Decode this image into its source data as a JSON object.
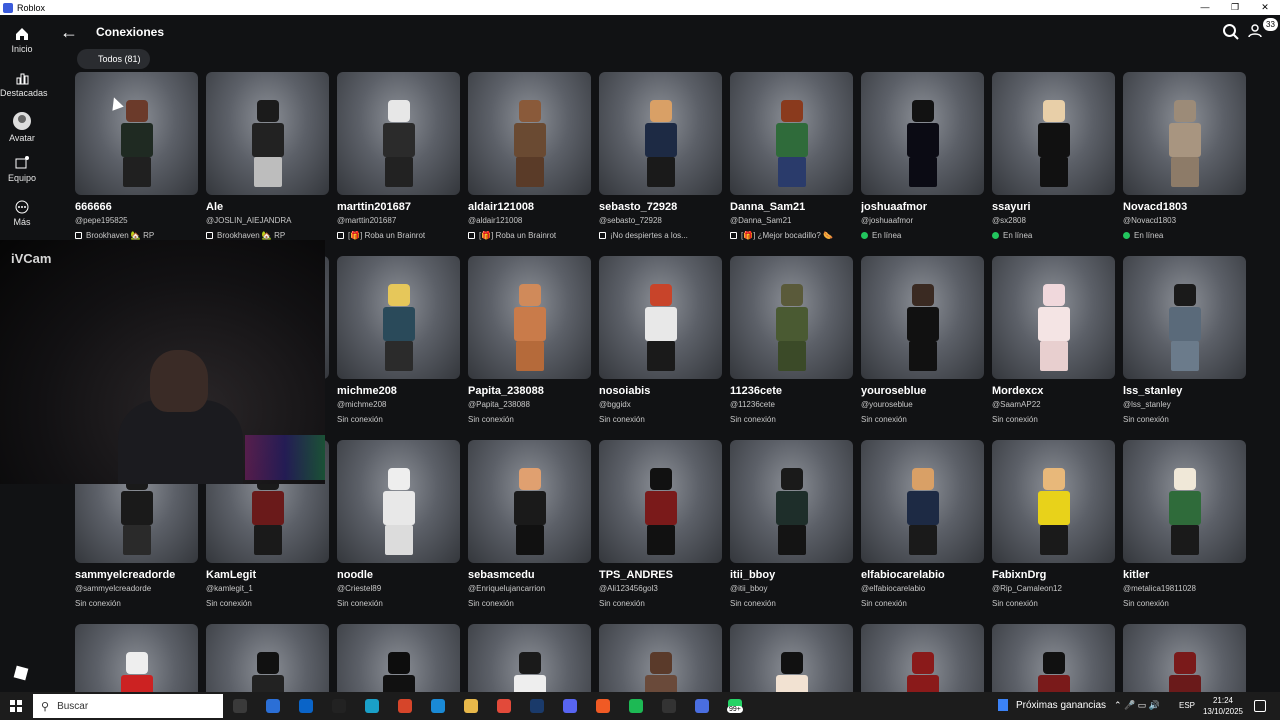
{
  "window": {
    "title": "Roblox",
    "controls": [
      "—",
      "❐",
      "✕"
    ]
  },
  "sidebar": {
    "items": [
      {
        "label": "Inicio",
        "icon": "home-icon"
      },
      {
        "label": "Destacadas",
        "icon": "chart-icon"
      },
      {
        "label": "Avatar",
        "icon": "avatar-icon"
      },
      {
        "label": "Equipo",
        "icon": "party-icon"
      },
      {
        "label": "Más",
        "icon": "more-icon"
      }
    ]
  },
  "header": {
    "title": "Conexiones",
    "notification_count": "33"
  },
  "filter": {
    "label": "Todos (81)"
  },
  "webcam": {
    "label": "iVCam"
  },
  "colors": {
    "online": "#22c55e",
    "card_bg": "#5c6068",
    "app_bg": "#111214"
  },
  "connections": [
    {
      "name": "666666",
      "handle": "@pepe195825",
      "status": "Brookhaven 🏡 RP",
      "status_type": "game",
      "head": "#6b3a2a",
      "body": "#1f2a22",
      "legs": "#202020"
    },
    {
      "name": "Ale",
      "handle": "@JOSLIN_AIEJANDRA",
      "status": "Brookhaven 🏡 RP",
      "status_type": "game",
      "head": "#1b1b1b",
      "body": "#222",
      "legs": "#bdbdbd"
    },
    {
      "name": "marttin201687",
      "handle": "@marttin201687",
      "status": "[🎁] Roba un Brainrot",
      "status_type": "game",
      "head": "#e7e7e7",
      "body": "#2b2b2b",
      "legs": "#222"
    },
    {
      "name": "aldair121008",
      "handle": "@aldair121008",
      "status": "[🎁] Roba un Brainrot",
      "status_type": "game",
      "head": "#8a5a3a",
      "body": "#6a4a32",
      "legs": "#5a3b28"
    },
    {
      "name": "sebasto_72928",
      "handle": "@sebasto_72928",
      "status": "¡No despiertes a los...",
      "status_type": "game",
      "head": "#d9a066",
      "body": "#1d2a44",
      "legs": "#1a1a1a"
    },
    {
      "name": "Danna_Sam21",
      "handle": "@Danna_Sam21",
      "status": "[🎁] ¿Mejor bocadillo? 🌭",
      "status_type": "game",
      "head": "#8a3a1d",
      "body": "#2f6b3a",
      "legs": "#2a3b6b"
    },
    {
      "name": "joshuaafmor",
      "handle": "@joshuaafmor",
      "status": "En línea",
      "status_type": "online",
      "head": "#121212",
      "body": "#0b0b14",
      "legs": "#0b0b14"
    },
    {
      "name": "ssayuri",
      "handle": "@sx2808",
      "status": "En línea",
      "status_type": "online",
      "head": "#e8cfa8",
      "body": "#111",
      "legs": "#111"
    },
    {
      "name": "Novacd1803",
      "handle": "@Novacd1803",
      "status": "En línea",
      "status_type": "online",
      "head": "#9c8b78",
      "body": "#a89580",
      "legs": "#8d7b68"
    },
    {
      "name": "",
      "handle": "",
      "status": "",
      "status_type": "hidden",
      "head": "#555",
      "body": "#444",
      "legs": "#333"
    },
    {
      "name": "",
      "handle": "",
      "status": "",
      "status_type": "hidden",
      "head": "#555",
      "body": "#444",
      "legs": "#333"
    },
    {
      "name": "michme208",
      "handle": "@michme208",
      "status": "Sin conexión",
      "status_type": "offline",
      "head": "#e6c75a",
      "body": "#2a4a5a",
      "legs": "#2b2b2b"
    },
    {
      "name": "Papita_238088",
      "handle": "@Papita_238088",
      "status": "Sin conexión",
      "status_type": "offline",
      "head": "#d08a5a",
      "body": "#c97b4a",
      "legs": "#b56a3a"
    },
    {
      "name": "nosoiabis",
      "handle": "@bggidx",
      "status": "Sin conexión",
      "status_type": "offline",
      "head": "#c8442a",
      "body": "#e8e8e8",
      "legs": "#1a1a1a"
    },
    {
      "name": "11236cete",
      "handle": "@11236cete",
      "status": "Sin conexión",
      "status_type": "offline",
      "head": "#5a5a3a",
      "body": "#4a5a32",
      "legs": "#3b4a28"
    },
    {
      "name": "youroseblue",
      "handle": "@youroseblue",
      "status": "Sin conexión",
      "status_type": "offline",
      "head": "#3a2a22",
      "body": "#111",
      "legs": "#111"
    },
    {
      "name": "Mordexcx",
      "handle": "@SaamAP22",
      "status": "Sin conexión",
      "status_type": "offline",
      "head": "#f0d8dc",
      "body": "#f4e4e4",
      "legs": "#e8cfcf"
    },
    {
      "name": "lss_stanley",
      "handle": "@lss_stanley",
      "status": "Sin conexión",
      "status_type": "offline",
      "head": "#1a1a1a",
      "body": "#5a6a7a",
      "legs": "#6b7b8b"
    },
    {
      "name": "sammyelcreadorde",
      "handle": "@sammyelcreadorde",
      "status": "Sin conexión",
      "status_type": "offline",
      "head": "#1a1a1a",
      "body": "#1a1a1a",
      "legs": "#2a2a2a"
    },
    {
      "name": "KamLegit",
      "handle": "@kamlegit_1",
      "status": "Sin conexión",
      "status_type": "offline",
      "head": "#1a1a1a",
      "body": "#6a1a1a",
      "legs": "#1a1a1a"
    },
    {
      "name": "noodle",
      "handle": "@Criestel89",
      "status": "Sin conexión",
      "status_type": "offline",
      "head": "#eeeeee",
      "body": "#e8e8e8",
      "legs": "#dcdcdc"
    },
    {
      "name": "sebasmcedu",
      "handle": "@Enriquelujancarrion",
      "status": "Sin conexión",
      "status_type": "offline",
      "head": "#e0a070",
      "body": "#1a1a1a",
      "legs": "#111"
    },
    {
      "name": "TPS_ANDRES",
      "handle": "@Ali123456gol3",
      "status": "Sin conexión",
      "status_type": "offline",
      "head": "#111",
      "body": "#7a1a1a",
      "legs": "#111"
    },
    {
      "name": "itii_bboy",
      "handle": "@itii_bboy",
      "status": "Sin conexión",
      "status_type": "offline",
      "head": "#1a1a1a",
      "body": "#1e2e2a",
      "legs": "#141414"
    },
    {
      "name": "elfabiocarelabio",
      "handle": "@elfabiocarelabio",
      "status": "Sin conexión",
      "status_type": "offline",
      "head": "#d9a066",
      "body": "#1d2a44",
      "legs": "#1a1a1a"
    },
    {
      "name": "FabixnDrg",
      "handle": "@Rip_Camaleon12",
      "status": "Sin conexión",
      "status_type": "offline",
      "head": "#e8b87a",
      "body": "#e8d21a",
      "legs": "#1a1a1a"
    },
    {
      "name": "kitler",
      "handle": "@metalica19811028",
      "status": "Sin conexión",
      "status_type": "offline",
      "head": "#f0e8d8",
      "body": "#2f6b3a",
      "legs": "#1a1a1a"
    },
    {
      "name": "",
      "handle": "",
      "status": "",
      "status_type": "hidden",
      "head": "#eee",
      "body": "#c22",
      "legs": "#eee"
    },
    {
      "name": "",
      "handle": "",
      "status": "",
      "status_type": "hidden",
      "head": "#111",
      "body": "#222",
      "legs": "#111"
    },
    {
      "name": "",
      "handle": "",
      "status": "",
      "status_type": "hidden",
      "head": "#0d0d0d",
      "body": "#111",
      "legs": "#111"
    },
    {
      "name": "",
      "handle": "",
      "status": "",
      "status_type": "hidden",
      "head": "#1a1a1a",
      "body": "#eee",
      "legs": "#111"
    },
    {
      "name": "",
      "handle": "",
      "status": "",
      "status_type": "hidden",
      "head": "#5a3a2a",
      "body": "#6a4a3a",
      "legs": "#4a2a1a"
    },
    {
      "name": "",
      "handle": "",
      "status": "",
      "status_type": "hidden",
      "head": "#111",
      "body": "#f2e2d2",
      "legs": "#111"
    },
    {
      "name": "",
      "handle": "",
      "status": "",
      "status_type": "hidden",
      "head": "#8a1a1a",
      "body": "#8a1a1a",
      "legs": "#5a0a0a"
    },
    {
      "name": "",
      "handle": "",
      "status": "",
      "status_type": "hidden",
      "head": "#111",
      "body": "#7a1a1a",
      "legs": "#111"
    },
    {
      "name": "",
      "handle": "",
      "status": "",
      "status_type": "hidden",
      "head": "#7a1a1a",
      "body": "#6a1a1a",
      "legs": "#4a0a0a"
    }
  ],
  "taskbar": {
    "search_placeholder": "Buscar",
    "weather_text": "Próximas ganancias",
    "language": "ESP",
    "time": "21:24",
    "date": "13/10/2025",
    "badge": "99+",
    "apps": [
      {
        "icon": "task-view-icon",
        "color": "#3a3a3a"
      },
      {
        "icon": "store-icon",
        "color": "#2b6fd6"
      },
      {
        "icon": "outlook-icon",
        "color": "#0a64c8"
      },
      {
        "icon": "capcut-icon",
        "color": "#222"
      },
      {
        "icon": "edge-icon",
        "color": "#1aa0c8"
      },
      {
        "icon": "app-4-icon",
        "color": "#d6452a"
      },
      {
        "icon": "vscode-icon",
        "color": "#1a8ad6"
      },
      {
        "icon": "folder-icon",
        "color": "#e8b84a"
      },
      {
        "icon": "chrome-icon",
        "color": "#e24a3a"
      },
      {
        "icon": "steam-icon",
        "color": "#1a3a6a"
      },
      {
        "icon": "discord-icon",
        "color": "#5865f2"
      },
      {
        "icon": "brave-icon",
        "color": "#f05a24"
      },
      {
        "icon": "spotify-icon",
        "color": "#1db954"
      },
      {
        "icon": "obs-icon",
        "color": "#333"
      },
      {
        "icon": "roblox-icon",
        "color": "#4a6ee0"
      },
      {
        "icon": "whatsapp-icon",
        "color": "#25d366"
      }
    ]
  }
}
